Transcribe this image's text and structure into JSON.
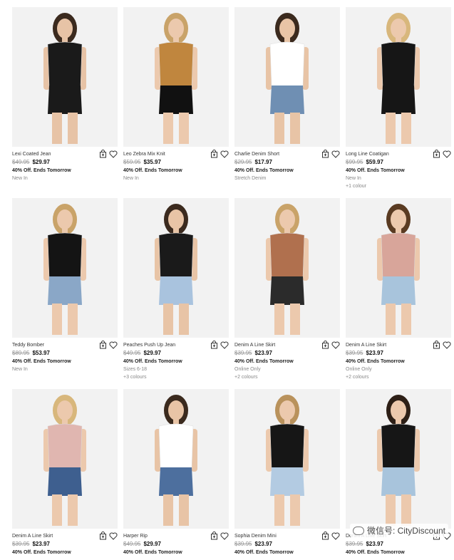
{
  "products": [
    {
      "name": "Lexi Coated Jean",
      "was": "$49.95",
      "now": "$29.97",
      "promo": "40% Off. Ends Tomorrow",
      "tag": "New In",
      "colours": "",
      "top": "#1a1a1a",
      "bottom": "#1a1a1a",
      "bg": "#f2f2f2",
      "skin": "#e7c3a6",
      "hair": "#3b2a1e"
    },
    {
      "name": "Leo Zebra Mix Knit",
      "was": "$59.95",
      "now": "$35.97",
      "promo": "40% Off. Ends Tomorrow",
      "tag": "New In",
      "colours": "",
      "top": "#c0863e",
      "bottom": "#111111",
      "bg": "#f2f2f2",
      "skin": "#ecc9ad",
      "hair": "#c9a369"
    },
    {
      "name": "Charlie Denim Short",
      "was": "$29.95",
      "now": "$17.97",
      "promo": "40% Off. Ends Tomorrow",
      "tag": "Stretch Denim",
      "colours": "",
      "top": "#ffffff",
      "bottom": "#6f8fb3",
      "bg": "#f2f2f2",
      "skin": "#e8c4a6",
      "hair": "#3b2a1e"
    },
    {
      "name": "Long Line Coatigan",
      "was": "$99.95",
      "now": "$59.97",
      "promo": "40% Off. Ends Tomorrow",
      "tag": "New In",
      "colours": "+1 colour",
      "top": "#161616",
      "bottom": "#161616",
      "bg": "#f2f2f2",
      "skin": "#ecc9ad",
      "hair": "#d8b77c"
    },
    {
      "name": "Teddy Bomber",
      "was": "$89.95",
      "now": "$53.97",
      "promo": "40% Off. Ends Tomorrow",
      "tag": "New In",
      "colours": "",
      "top": "#141414",
      "bottom": "#8aa7c7",
      "bg": "#f2f2f2",
      "skin": "#ecc9ad",
      "hair": "#c9a369"
    },
    {
      "name": "Peaches Push Up Jean",
      "was": "$49.95",
      "now": "$29.97",
      "promo": "40% Off. Ends Tomorrow",
      "tag": "Sizes 6-18",
      "colours": "+3 colours",
      "top": "#1a1a1a",
      "bottom": "#a9c3de",
      "bg": "#f2f2f2",
      "skin": "#e8c4a6",
      "hair": "#3b2a1e"
    },
    {
      "name": "Denim A Line Skirt",
      "was": "$39.95",
      "now": "$23.97",
      "promo": "40% Off. Ends Tomorrow",
      "tag": "Online Only",
      "colours": "+2 colours",
      "top": "#b0704e",
      "bottom": "#2b2b2b",
      "bg": "#f2f2f2",
      "skin": "#ecc9ad",
      "hair": "#c9a369"
    },
    {
      "name": "Denim A Line Skirt",
      "was": "$39.95",
      "now": "$23.97",
      "promo": "40% Off. Ends Tomorrow",
      "tag": "Online Only",
      "colours": "+2 colours",
      "top": "#d8a59a",
      "bottom": "#a8c4dc",
      "bg": "#f2f2f2",
      "skin": "#ecc9ad",
      "hair": "#5a3b22"
    },
    {
      "name": "Denim A Line Skirt",
      "was": "$39.95",
      "now": "$23.97",
      "promo": "40% Off. Ends Tomorrow",
      "tag": "",
      "colours": "",
      "top": "#e0b6b0",
      "bottom": "#3e5f8f",
      "bg": "#f2f2f2",
      "skin": "#ecc9ad",
      "hair": "#d8b77c"
    },
    {
      "name": "Harper Rip",
      "was": "$49.95",
      "now": "$29.97",
      "promo": "40% Off. Ends Tomorrow",
      "tag": "",
      "colours": "",
      "top": "#ffffff",
      "bottom": "#4d6f9e",
      "bg": "#f2f2f2",
      "skin": "#e8c4a6",
      "hair": "#3b2a1e"
    },
    {
      "name": "Sophia Denim Mini",
      "was": "$39.95",
      "now": "$23.97",
      "promo": "40% Off. Ends Tomorrow",
      "tag": "",
      "colours": "",
      "top": "#161616",
      "bottom": "#b3cbe2",
      "bg": "#f2f2f2",
      "skin": "#ecc9ad",
      "hair": "#b9925c"
    },
    {
      "name": "Denim A Line Skirt",
      "was": "$39.95",
      "now": "$23.97",
      "promo": "40% Off. Ends Tomorrow",
      "tag": "",
      "colours": "",
      "top": "#161616",
      "bottom": "#a8c4dc",
      "bg": "#f2f2f2",
      "skin": "#ecc9ad",
      "hair": "#2d1f16"
    }
  ],
  "watermark": "微信号: CityDiscount",
  "icons": {
    "bag": "add-to-bag-icon",
    "wish": "heart-icon"
  }
}
